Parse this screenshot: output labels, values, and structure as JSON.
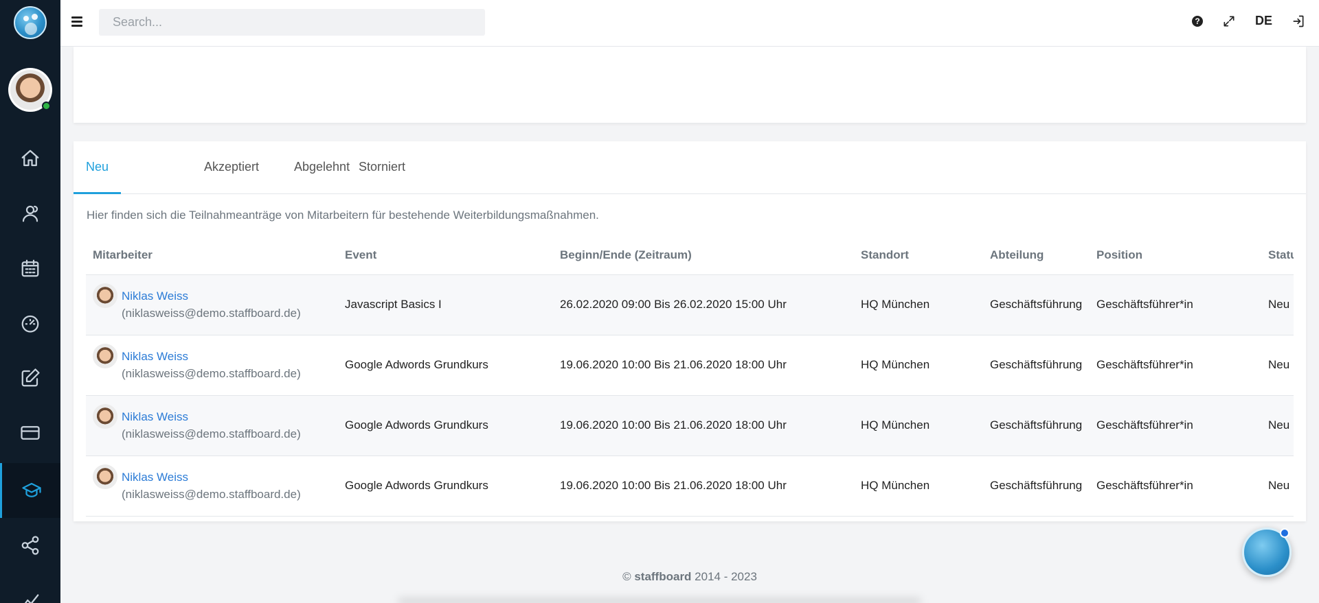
{
  "topbar": {
    "search_placeholder": "Search...",
    "language": "DE"
  },
  "tabs": [
    {
      "label": "Neu",
      "active": true
    },
    {
      "label": "Akzeptiert",
      "active": false
    },
    {
      "label": "Abgelehnt",
      "active": false
    },
    {
      "label": "Storniert",
      "active": false
    }
  ],
  "description": "Hier finden sich die Teilnahmeanträge von Mitarbeitern für bestehende Weiterbildungsmaßnahmen.",
  "table": {
    "headers": [
      "Mitarbeiter",
      "Event",
      "Beginn/Ende (Zeitraum)",
      "Standort",
      "Abteilung",
      "Position",
      "Status"
    ],
    "rows": [
      {
        "name": "Niklas Weiss",
        "email": "(niklasweiss@demo.staffboard.de)",
        "event": "Javascript Basics I",
        "period": "26.02.2020 09:00 Bis 26.02.2020 15:00 Uhr",
        "location": "HQ München",
        "department": "Geschäftsführung",
        "position": "Geschäftsführer*in",
        "status": "Neu"
      },
      {
        "name": "Niklas Weiss",
        "email": "(niklasweiss@demo.staffboard.de)",
        "event": "Google Adwords Grundkurs",
        "period": "19.06.2020 10:00 Bis 21.06.2020 18:00 Uhr",
        "location": "HQ München",
        "department": "Geschäftsführung",
        "position": "Geschäftsführer*in",
        "status": "Neu"
      },
      {
        "name": "Niklas Weiss",
        "email": "(niklasweiss@demo.staffboard.de)",
        "event": "Google Adwords Grundkurs",
        "period": "19.06.2020 10:00 Bis 21.06.2020 18:00 Uhr",
        "location": "HQ München",
        "department": "Geschäftsführung",
        "position": "Geschäftsführer*in",
        "status": "Neu"
      },
      {
        "name": "Niklas Weiss",
        "email": "(niklasweiss@demo.staffboard.de)",
        "event": "Google Adwords Grundkurs",
        "period": "19.06.2020 10:00 Bis 21.06.2020 18:00 Uhr",
        "location": "HQ München",
        "department": "Geschäftsführung",
        "position": "Geschäftsführer*in",
        "status": "Neu"
      }
    ]
  },
  "footer": {
    "prefix": "© ",
    "brand": "staffboard",
    "years": " 2014 - 2023"
  },
  "colors": {
    "sidebar": "#0f1c29",
    "accent": "#1fa0dc",
    "link": "#2b7bd6"
  },
  "icons": {
    "sidebar": [
      "home-icon",
      "users-icon",
      "calendar-icon",
      "gauge-icon",
      "edit-icon",
      "card-icon",
      "graduation-cap-icon",
      "share-icon",
      "chart-icon"
    ],
    "topbar": [
      "menu-icon",
      "help-icon",
      "fullscreen-icon",
      "logout-icon"
    ]
  }
}
